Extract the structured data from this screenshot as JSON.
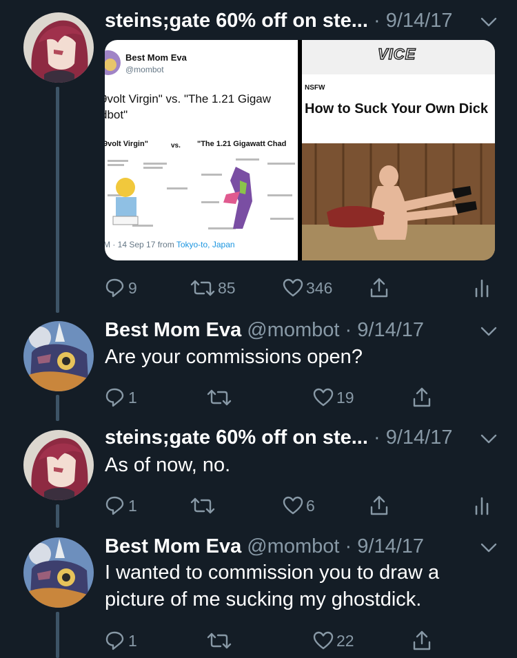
{
  "tweets": [
    {
      "name": "steins;gate 60% off on ste...",
      "handle": "",
      "time": "9/14/17",
      "text": "",
      "actions": {
        "replies": "9",
        "retweets": "85",
        "likes": "346"
      },
      "has_analytics": true,
      "media": {
        "left": {
          "name": "Best Mom Eva",
          "handle": "@mombot",
          "text": "9volt Virgin\" vs. \"The 1.21 Gigaw\ndbot\"",
          "label_left": "9volt Virgin\"",
          "label_vs": "vs.",
          "label_right": "\"The 1.21 Gigawatt Chad",
          "footer_prefix": "M · 14 Sep 17 from ",
          "footer_place": "Tokyo-to, Japan"
        },
        "right": {
          "logo": "VICE",
          "tag": "NSFW",
          "headline": "How to Suck Your Own Dick"
        }
      }
    },
    {
      "name": "Best Mom Eva",
      "handle": "@mombot",
      "time": "9/14/17",
      "text": "Are your commissions open?",
      "actions": {
        "replies": "1",
        "retweets": "",
        "likes": "19"
      },
      "has_analytics": false
    },
    {
      "name": "steins;gate 60% off on ste...",
      "handle": "",
      "time": "9/14/17",
      "text": "As of now, no.",
      "actions": {
        "replies": "1",
        "retweets": "",
        "likes": "6"
      },
      "has_analytics": true
    },
    {
      "name": "Best Mom Eva",
      "handle": "@mombot",
      "time": "9/14/17",
      "text": "I wanted to commission you to draw a picture of me sucking my ghostdick.",
      "actions": {
        "replies": "1",
        "retweets": "",
        "likes": "22"
      },
      "has_analytics": false
    }
  ],
  "colors": {
    "background": "#141d26",
    "secondary_text": "#8899a6",
    "thread_line": "#3d5466",
    "link": "#1b95e0"
  },
  "icons": [
    "reply-icon",
    "retweet-icon",
    "like-icon",
    "share-icon",
    "analytics-icon",
    "chevron-down-icon"
  ]
}
